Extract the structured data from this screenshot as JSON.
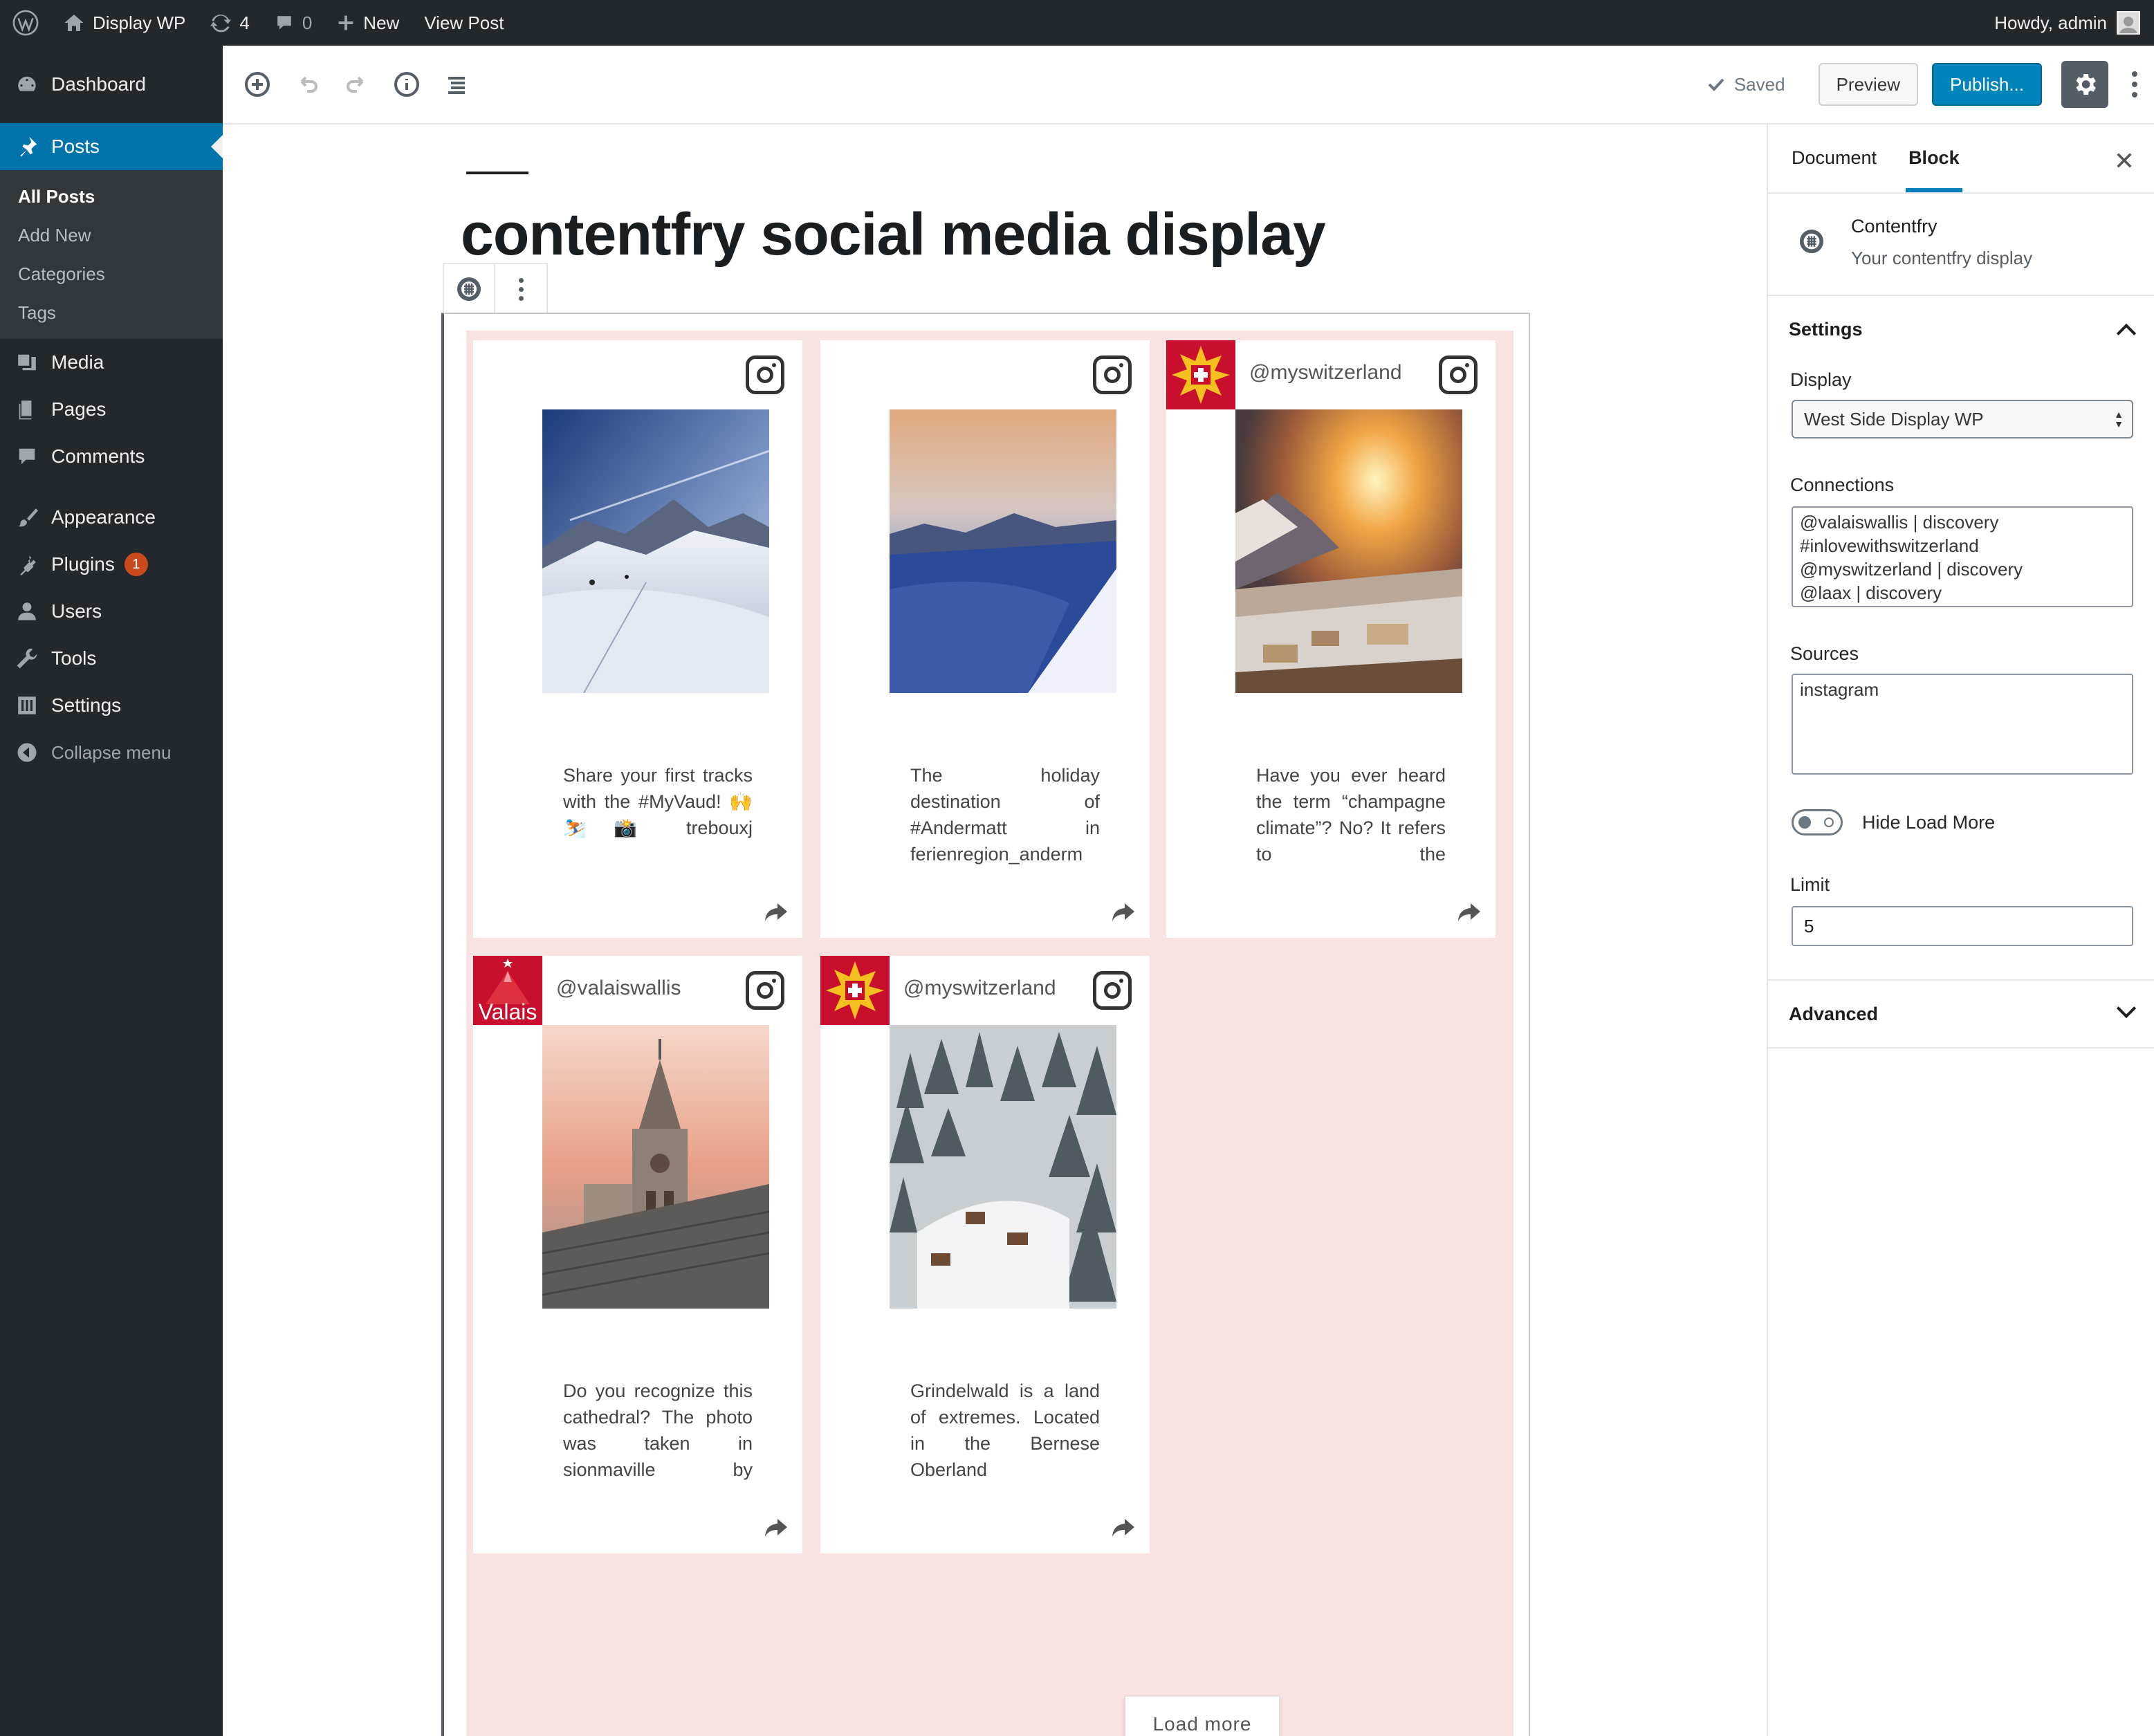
{
  "adminbar": {
    "site_name": "Display WP",
    "updates_count": "4",
    "comments_count": "0",
    "new_label": "New",
    "view_post_label": "View Post",
    "howdy": "Howdy, admin"
  },
  "sidebar": {
    "dashboard": "Dashboard",
    "posts": "Posts",
    "posts_sub": [
      "All Posts",
      "Add New",
      "Categories",
      "Tags"
    ],
    "media": "Media",
    "pages": "Pages",
    "comments": "Comments",
    "appearance": "Appearance",
    "plugins": "Plugins",
    "plugins_badge": "1",
    "users": "Users",
    "tools": "Tools",
    "settings": "Settings",
    "collapse": "Collapse menu"
  },
  "header": {
    "saved": "Saved",
    "preview": "Preview",
    "publish": "Publish..."
  },
  "post": {
    "title": "contentfry social media display"
  },
  "feed": {
    "cards": [
      {
        "handle": "",
        "caption": "Share your first tracks with the #MyVaud! 🙌 ⛷️ 📸 trebouxj"
      },
      {
        "handle": "",
        "caption": "The holiday destination of #Andermatt in ferienregion_anderm"
      },
      {
        "handle": "@myswitzerland",
        "caption": "Have you ever heard the term “champagne climate”? No? It refers to the"
      },
      {
        "handle": "@valaiswallis",
        "caption": "Do you recognize this cathedral? The photo was taken in sionmaville by"
      },
      {
        "handle": "@myswitzerland",
        "caption": "Grindelwald is a land of extremes. Located in the Bernese Oberland"
      }
    ],
    "valais_logo_text": "Valais",
    "load_more": "Load more"
  },
  "settings_panel": {
    "tab_document": "Document",
    "tab_block": "Block",
    "block_name": "Contentfry",
    "block_desc": "Your contentfry display",
    "section_settings": "Settings",
    "display_label": "Display",
    "display_value": "West Side Display WP",
    "connections_label": "Connections",
    "connections": [
      "@valaiswallis | discovery",
      "#inlovewithswitzerland",
      "@myswitzerland | discovery",
      "@laax | discovery"
    ],
    "sources_label": "Sources",
    "sources_value": "instagram",
    "hide_load_more": "Hide Load More",
    "limit_label": "Limit",
    "limit_value": "5",
    "section_advanced": "Advanced"
  },
  "colors": {
    "admin_dark": "#23282d",
    "accent_blue": "#0073aa",
    "publish_blue": "#0085ba",
    "feed_bg": "#f9e2e2",
    "switzerland_red": "#c8102e"
  }
}
